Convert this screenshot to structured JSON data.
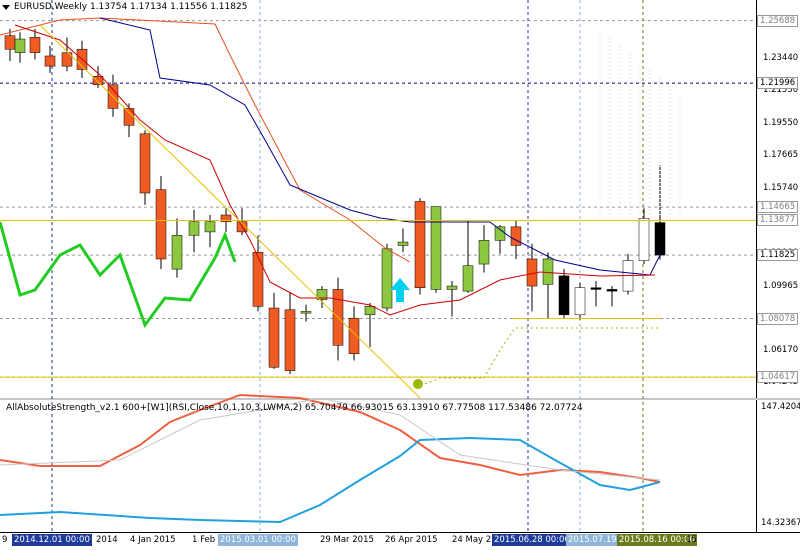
{
  "symbol": "EURUSD",
  "timeframe": "Weekly",
  "title_line": "EURUSD,Weekly  1.13754 1.17134 1.11556 1.11825",
  "ohlc": {
    "open": "1.13754",
    "high": "1.17134",
    "low": "1.11556",
    "close": "1.11825"
  },
  "price_axis": {
    "ticks": [
      "1.25385",
      "1.23440",
      "1.21550",
      "1.19550",
      "1.17665",
      "1.15740",
      "1.13850",
      "1.11900",
      "1.09965",
      "1.08030",
      "1.06170",
      "1.04245"
    ],
    "labels": [
      {
        "text": "1.25688",
        "bg": "#ffffff",
        "color": "#808080"
      },
      {
        "text": "1.21996",
        "bg": "#ffffff",
        "color": "#000000"
      },
      {
        "text": "1.14665",
        "bg": "#ffffff",
        "color": "#808080"
      },
      {
        "text": "1.13877",
        "bg": "#ffffff",
        "color": "#808080"
      },
      {
        "text": "1.11825",
        "bg": "#ffffff",
        "color": "#000000"
      },
      {
        "text": "1.08078",
        "bg": "#ffffff",
        "color": "#808080"
      },
      {
        "text": "1.04617",
        "bg": "#ffffff",
        "color": "#808080"
      }
    ]
  },
  "indicator": {
    "title": "AllAbsoluteStrength_v2.1 600+[W1](RSI,Close,10,1,10,3,LWMA,2) 65.70479 66.93015 63.13910 67.77508 117.53486 72.07724",
    "max_label": "147.4204",
    "min_label": "14.32367"
  },
  "time_axis": {
    "labels": [
      {
        "text": "9",
        "hl": false
      },
      {
        "text": "2014.12.01 00:00",
        "hl": true,
        "bg": "#1e3a9a"
      },
      {
        "text": "2014",
        "hl": false
      },
      {
        "text": "4 Jan 2015",
        "hl": false
      },
      {
        "text": "1 Feb",
        "hl": false
      },
      {
        "text": "2015.03.01 00:00",
        "hl": true,
        "bg": "#8fb5d8"
      },
      {
        "text": "29 Mar 2015",
        "hl": false
      },
      {
        "text": "26 Apr 2015",
        "hl": false
      },
      {
        "text": "24 May 2",
        "hl": false
      },
      {
        "text": "2015.06.28 00:00",
        "hl": true,
        "bg": "#1e3a9a"
      },
      {
        "text": "2015.07.19 00:00",
        "hl": true,
        "bg": "#8fb5d8"
      },
      {
        "text": "2015.08.16 00:00",
        "hl": true,
        "bg": "#6b7a1a"
      },
      {
        "text": "15",
        "hl": false
      }
    ]
  },
  "colors": {
    "bull": "#8dc63f",
    "bear": "#f05a23",
    "blue_line": "#00008b",
    "red_line": "#cc0000",
    "orange_line": "#e8501a",
    "yellow_line": "#e6c200",
    "green_line": "#22cc22",
    "cyan_arrow": "#00d0f0",
    "ind_red": "#f06040",
    "ind_blue": "#20a0e0"
  },
  "icons": {
    "arrow": "up-arrow-icon",
    "menu": "dropdown-triangle-icon",
    "dot": "circle-marker-icon"
  }
}
